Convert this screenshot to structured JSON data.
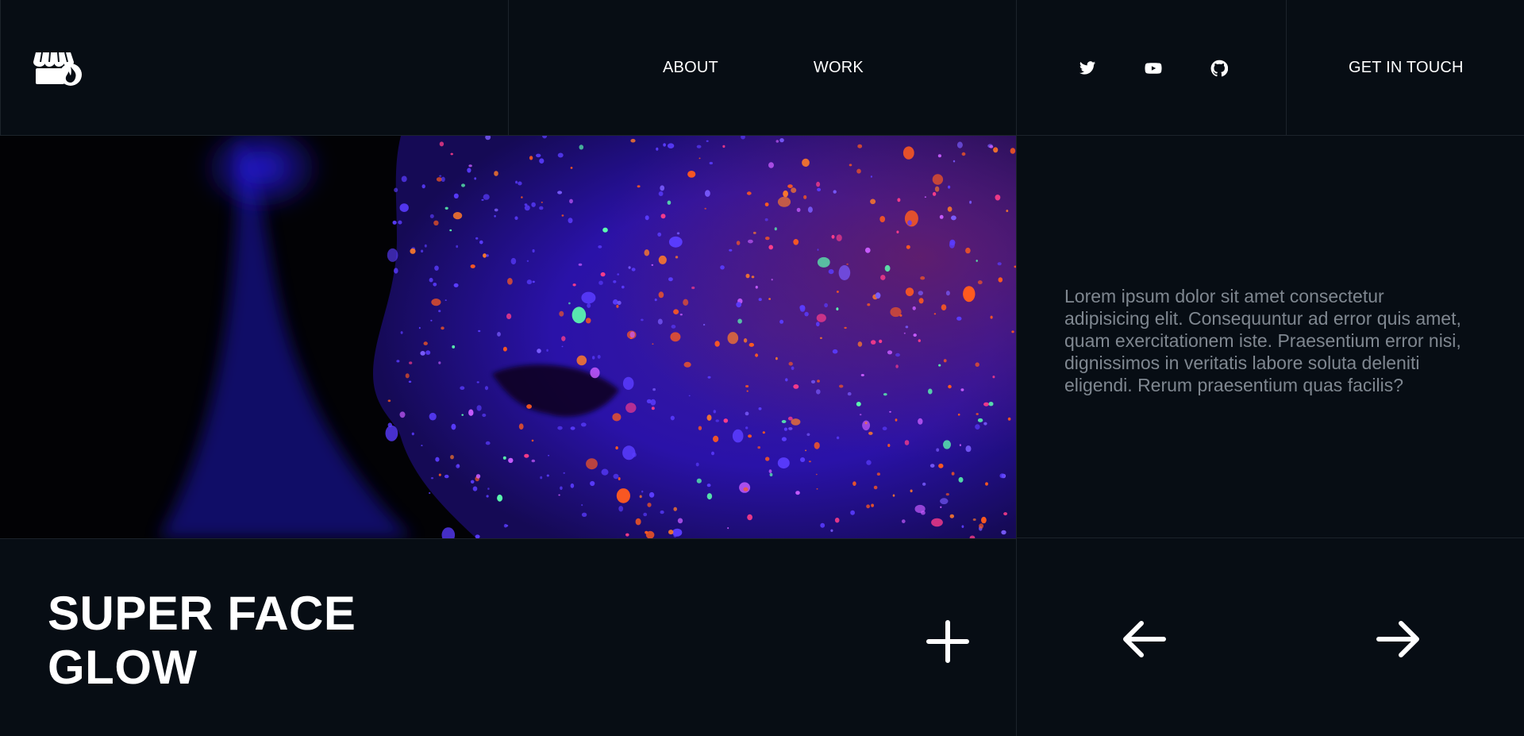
{
  "header": {
    "logo_icon": "shop-fire-icon",
    "nav": [
      {
        "label": "ABOUT"
      },
      {
        "label": "WORK"
      }
    ],
    "social": [
      {
        "icon": "twitter-icon"
      },
      {
        "icon": "youtube-icon"
      },
      {
        "icon": "github-icon"
      }
    ],
    "cta_label": "GET IN TOUCH"
  },
  "hero": {
    "image_subject": "neon-paint-face-photo",
    "description": "Lorem ipsum dolor sit amet consectetur adipisicing elit. Consequuntur ad error quis amet, quam exercitationem iste. Praesentium error nisi, dignissimos in veritatis labore soluta deleniti eligendi. Rerum praesentium quas facilis?"
  },
  "footer": {
    "title": "SUPER FACE GLOW",
    "plus_icon": "plus-icon",
    "prev_icon": "arrow-left-icon",
    "next_icon": "arrow-right-icon"
  },
  "colors": {
    "background": "#070d14",
    "divider": "#1c232b",
    "text_muted": "#7f8790",
    "neon_orange": "#ff5a1f",
    "neon_green": "#5dffb0",
    "neon_blue": "#3a22ff"
  }
}
